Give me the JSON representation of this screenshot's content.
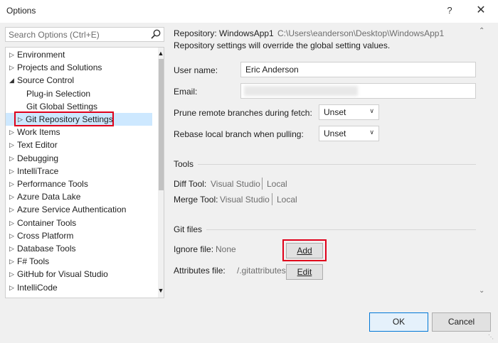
{
  "window": {
    "title": "Options",
    "help": "?",
    "close": "✕"
  },
  "search": {
    "placeholder": "Search Options (Ctrl+E)"
  },
  "tree": {
    "items": [
      {
        "label": "Environment",
        "arrow": "▷"
      },
      {
        "label": "Projects and Solutions",
        "arrow": "▷"
      },
      {
        "label": "Source Control",
        "arrow": "◢"
      },
      {
        "label": "Plug-in Selection",
        "arrow": ""
      },
      {
        "label": "Git Global Settings",
        "arrow": ""
      },
      {
        "label": "Git Repository Settings",
        "arrow": "▷"
      },
      {
        "label": "Work Items",
        "arrow": "▷"
      },
      {
        "label": "Text Editor",
        "arrow": "▷"
      },
      {
        "label": "Debugging",
        "arrow": "▷"
      },
      {
        "label": "IntelliTrace",
        "arrow": "▷"
      },
      {
        "label": "Performance Tools",
        "arrow": "▷"
      },
      {
        "label": "Azure Data Lake",
        "arrow": "▷"
      },
      {
        "label": "Azure Service Authentication",
        "arrow": "▷"
      },
      {
        "label": "Container Tools",
        "arrow": "▷"
      },
      {
        "label": "Cross Platform",
        "arrow": "▷"
      },
      {
        "label": "Database Tools",
        "arrow": "▷"
      },
      {
        "label": "F# Tools",
        "arrow": "▷"
      },
      {
        "label": "GitHub for Visual Studio",
        "arrow": "▷"
      },
      {
        "label": "IntelliCode",
        "arrow": "▷"
      }
    ],
    "selected_index": 5
  },
  "repo": {
    "label": "Repository: WindowsApp1",
    "path": "C:\\Users\\eanderson\\Desktop\\WindowsApp1",
    "note": "Repository settings will override the global setting values."
  },
  "form": {
    "user_name_label": "User name:",
    "user_name_value": "Eric Anderson",
    "email_label": "Email:",
    "email_value": "",
    "prune_label": "Prune remote branches during fetch:",
    "prune_value": "Unset",
    "rebase_label": "Rebase local branch when pulling:",
    "rebase_value": "Unset"
  },
  "tools": {
    "header": "Tools",
    "diff_label": "Diff Tool:",
    "diff_vs": "Visual Studio",
    "diff_local": "Local",
    "merge_label": "Merge Tool:",
    "merge_vs": "Visual Studio",
    "merge_local": "Local"
  },
  "git_files": {
    "header": "Git files",
    "ignore_label": "Ignore file:",
    "ignore_value": "None",
    "add_button": "Add",
    "attributes_label": "Attributes file:",
    "attributes_value": "/.gitattributes",
    "edit_button": "Edit"
  },
  "footer": {
    "ok": "OK",
    "cancel": "Cancel"
  },
  "colors": {
    "highlight": "#e0001b",
    "selection": "#cde8ff"
  }
}
